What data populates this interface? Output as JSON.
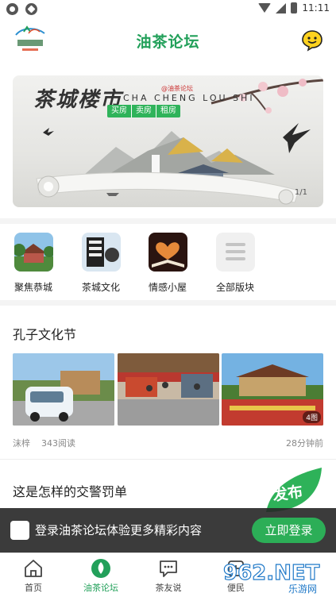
{
  "status_bar": {
    "time": "11:11"
  },
  "header": {
    "title": "油茶论坛"
  },
  "banner": {
    "title": "茶城楼市",
    "pinyin": "CHA CHENG LOU SHI",
    "tag": "@油茶论坛",
    "pills": [
      "买房",
      "卖房",
      "租房"
    ],
    "index": "1/1"
  },
  "sections": [
    {
      "label": "聚焦恭城",
      "icon": "temple-photo-icon"
    },
    {
      "label": "茶城文化",
      "icon": "tea-culture-icon"
    },
    {
      "label": "情感小屋",
      "icon": "open-book-heart-icon"
    },
    {
      "label": "全部版块",
      "icon": "list-icon"
    }
  ],
  "posts": [
    {
      "title": "孔子文化节",
      "author": "沫梓",
      "views": "343阅读",
      "time": "28分钟前",
      "image_count": "4图"
    },
    {
      "title": "这是怎样的交警罚单"
    }
  ],
  "fab": {
    "label": "发布"
  },
  "login_banner": {
    "text": "登录油茶论坛体验更多精彩内容",
    "button": "立即登录"
  },
  "tabs": [
    {
      "label": "首页",
      "icon": "home-icon",
      "active": false
    },
    {
      "label": "油茶论坛",
      "icon": "forum-icon",
      "active": true
    },
    {
      "label": "茶友说",
      "icon": "chat-icon",
      "active": false
    },
    {
      "label": "便民",
      "icon": "service-icon",
      "active": false
    }
  ],
  "watermark": {
    "text": "962.NET",
    "sub": "乐游网"
  },
  "colors": {
    "brand_green": "#22a05a",
    "login_button": "#2cae57"
  }
}
